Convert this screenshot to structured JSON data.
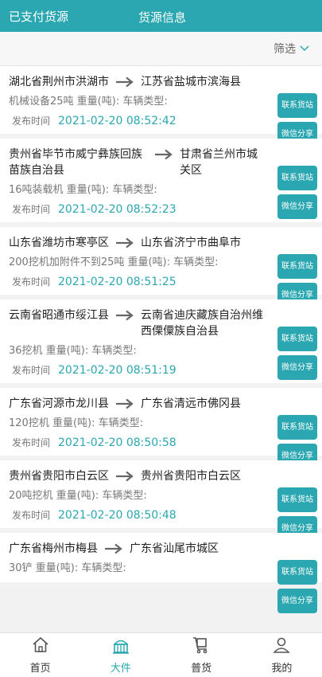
{
  "header": {
    "left_label": "已支付货源",
    "title": "货源信息"
  },
  "filter": {
    "label": "筛选"
  },
  "actions": {
    "contact_label": "联系货站",
    "share_label": "微信分享"
  },
  "time_label": "发布时间",
  "listings": [
    {
      "from": "湖北省荆州市洪湖市",
      "to": "江苏省盐城市滨海县",
      "info": "机械设备25吨 重量(吨): 车辆类型:",
      "time": "2021-02-20 08:52:42"
    },
    {
      "from": "贵州省毕节市威宁彝族回族苗族自治县",
      "to": "甘肃省兰州市城关区",
      "info": "16吨装载机 重量(吨): 车辆类型:",
      "time": "2021-02-20 08:52:23"
    },
    {
      "from": "山东省潍坊市寒亭区",
      "to": "山东省济宁市曲阜市",
      "info": "200挖机加附件不到25吨 重量(吨): 车辆类型:",
      "time": "2021-02-20 08:51:25"
    },
    {
      "from": "云南省昭通市绥江县",
      "to": "云南省迪庆藏族自治州维西傈僳族自治县",
      "info": "36挖机 重量(吨): 车辆类型:",
      "time": "2021-02-20 08:51:19"
    },
    {
      "from": "广东省河源市龙川县",
      "to": "广东省清远市佛冈县",
      "info": "120挖机 重量(吨): 车辆类型:",
      "time": "2021-02-20 08:50:58"
    },
    {
      "from": "贵州省贵阳市白云区",
      "to": "贵州省贵阳市白云区",
      "info": "20吨挖机 重量(吨): 车辆类型:",
      "time": "2021-02-20 08:50:48"
    },
    {
      "from": "广东省梅州市梅县",
      "to": "广东省汕尾市城区",
      "info": "30铲 重量(吨): 车辆类型:",
      "time": ""
    }
  ],
  "tabbar": {
    "items": [
      {
        "label": "首页",
        "icon": "home-icon",
        "active": false
      },
      {
        "label": "大件",
        "icon": "cargo-icon",
        "active": true
      },
      {
        "label": "普货",
        "icon": "parcel-cart-icon",
        "active": false
      },
      {
        "label": "我的",
        "icon": "profile-icon",
        "active": false
      }
    ]
  },
  "colors": {
    "accent": "#2aa7b1",
    "text": "#333333",
    "muted": "#777777"
  }
}
